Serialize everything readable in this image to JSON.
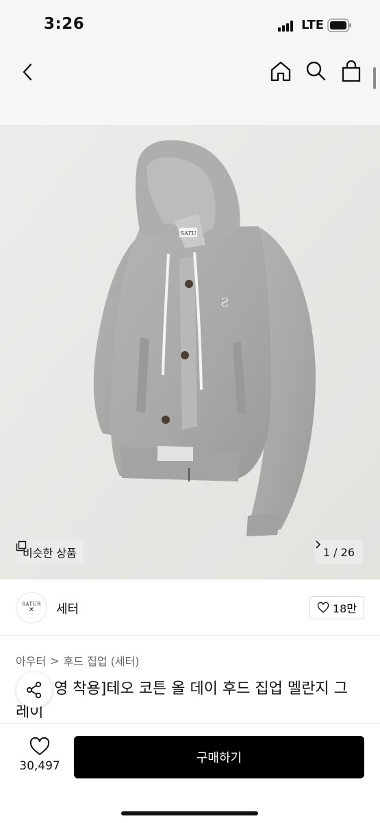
{
  "status_bar": {
    "time": "3:26",
    "network": "LTE"
  },
  "nav": {
    "back_icon": "chevron-left-icon",
    "home_icon": "home-icon",
    "search_icon": "search-icon",
    "bag_icon": "shopping-bag-icon"
  },
  "gallery": {
    "similar_label": "비슷한 상품",
    "counter": "1 / 26",
    "garment_tag_text": "SATU",
    "background_color": "#e9e9e7",
    "garment_color": "#a9aaa8"
  },
  "brand": {
    "logo_text": "SATUR",
    "logo_mark": "✕",
    "name": "세터",
    "likes": "18만"
  },
  "breadcrumb": {
    "category": "아우터",
    "subcategory": "후드 집업 (세터)",
    "separator": ">"
  },
  "product": {
    "title": "영 착용]테오 코튼 올 데이 후드 집업 멜란지 그레이"
  },
  "bottom_bar": {
    "wish_count": "30,497",
    "buy_label": "구매하기"
  },
  "colors": {
    "accent": "#000000",
    "nav_background": "#f6f6f6"
  }
}
